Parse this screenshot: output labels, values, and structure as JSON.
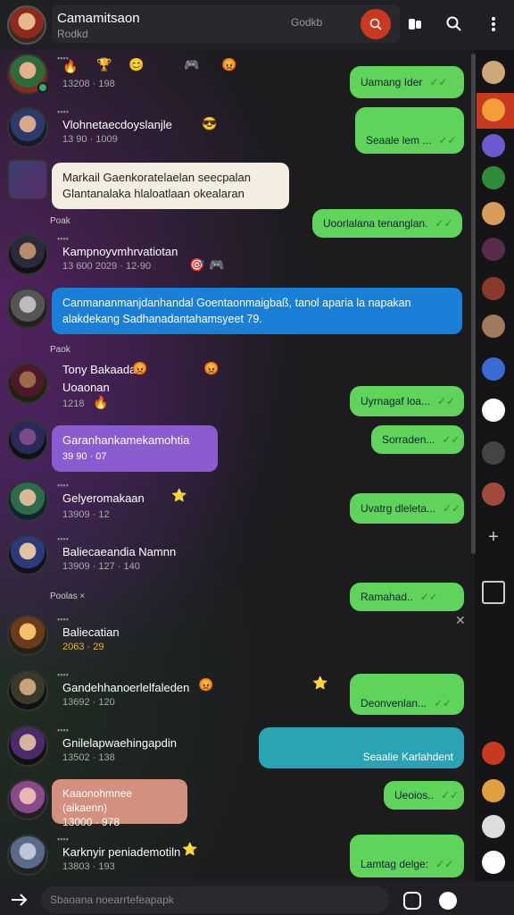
{
  "header": {
    "title": "Camamitsaon",
    "subtitle": "Rodkd",
    "search_label": "Godkb"
  },
  "chat": {
    "day_labels": [
      "Poak",
      "Paok",
      "Poolas ×"
    ],
    "messages": [
      {
        "type": "in",
        "meta": "13208 · 198"
      },
      {
        "type": "out",
        "text": "Uamang Ider"
      },
      {
        "type": "in",
        "text": "Vlohnetaecdoyslanjle",
        "meta": "13 90 · 1009"
      },
      {
        "type": "out",
        "text": "Seaale lem ..."
      },
      {
        "type": "in-bubble",
        "line1": "Markail Gaenkoratelaelan seecpalan",
        "line2": "Glantanalaka hlaloatlaan okealaran"
      },
      {
        "type": "out",
        "text": "Uoorlalana tenanglan."
      },
      {
        "type": "in",
        "text": "Kampnoyvmhrvatiotan",
        "meta": "13 600 2029 · 12-90"
      },
      {
        "type": "in-blue",
        "line1": "Canmananmanjdanhandal Goentaonmaigbaß, tanol aparia la napakan",
        "line2": "alakdekang Sadhanadantahamsyeet 79."
      },
      {
        "type": "in",
        "text": "Tony Bakaadan",
        "text2": "Uoaonan",
        "meta": "1218"
      },
      {
        "type": "out",
        "text": "Uyrnagaf loa..."
      },
      {
        "type": "in-purple",
        "line1": "Garanhankamekamohtia",
        "line2": "39 90 · 07"
      },
      {
        "type": "out",
        "text": "Sorraden..."
      },
      {
        "type": "in",
        "text": "Gelyeromakaan",
        "meta": "13909 · 12"
      },
      {
        "type": "out",
        "text": "Uvatrg dleleta..."
      },
      {
        "type": "in",
        "text": "Baliecaeandia Namnn",
        "meta": "13909 · 127 · 140"
      },
      {
        "type": "out",
        "text": "Ramahad.."
      },
      {
        "type": "in",
        "text": "Baliecatian",
        "meta": "2063 · 29"
      },
      {
        "type": "in",
        "text": "Gandehhanoerlelfaleden",
        "meta": "13692 · 120"
      },
      {
        "type": "out2",
        "line1": "",
        "line2": "Deonvenlan..."
      },
      {
        "type": "in",
        "text": "Gnilelapwaehingapdin",
        "meta": "13502 · 138"
      },
      {
        "type": "out-teal",
        "text": "Seaalie Karlahdent"
      },
      {
        "type": "in-pink",
        "line1": "Kaaonohmnee (aikaenn)",
        "line2": "13000 · 978"
      },
      {
        "type": "out",
        "text": "Ueoios.."
      },
      {
        "type": "in",
        "text": "Karknyir peniademotiln",
        "meta": "13803 · 193"
      },
      {
        "type": "out",
        "text": "Lamtag delge:"
      }
    ]
  },
  "input": {
    "placeholder": "Sbaoana noearrtefeapapk"
  },
  "colors": {
    "accent": "#c8391f",
    "out_bubble": "#5fd35a",
    "blue_bubble": "#1a7fd6",
    "purple_bubble": "#8a5ccf",
    "teal_bubble": "#2aa3b3",
    "pink_bubble": "#d4907e"
  },
  "icons": [
    "record-icon",
    "panel-icon",
    "search-icon",
    "more-vert-icon",
    "share-icon",
    "sticker-icon",
    "emoji-icon",
    "plus-icon",
    "gallery-icon"
  ]
}
